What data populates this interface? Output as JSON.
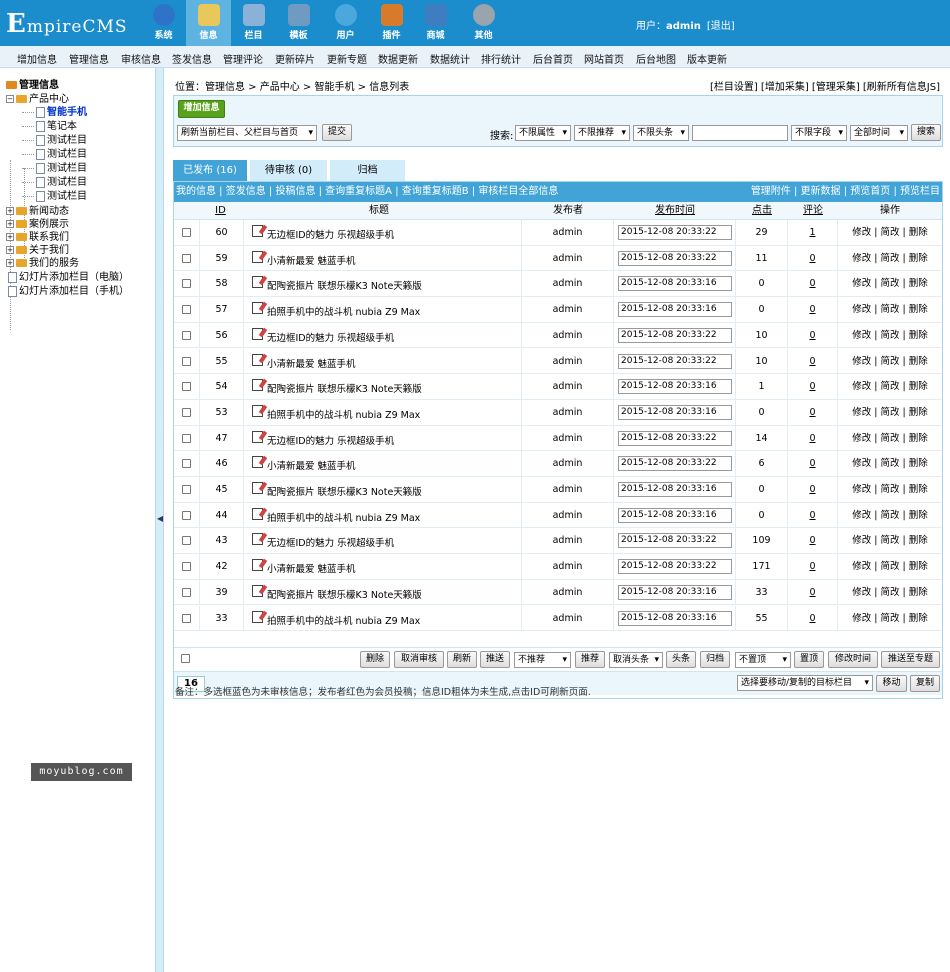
{
  "logo": {
    "text_big": "E",
    "text_rest": "mpireCMS"
  },
  "nav": [
    {
      "label": "系统",
      "icon": "globe-icon",
      "color": "#2f73c8"
    },
    {
      "label": "信息",
      "icon": "notepad-icon",
      "color": "#e8c85a"
    },
    {
      "label": "栏目",
      "icon": "folder-icon",
      "color": "#8ab2d8"
    },
    {
      "label": "模板",
      "icon": "window-icon",
      "color": "#6f9ac2"
    },
    {
      "label": "用户",
      "icon": "user-icon",
      "color": "#4aa8dd"
    },
    {
      "label": "插件",
      "icon": "tools-icon",
      "color": "#d87a2b"
    },
    {
      "label": "商城",
      "icon": "card-icon",
      "color": "#3e7ec0"
    },
    {
      "label": "其他",
      "icon": "gear-icon",
      "color": "#9aa4ad"
    }
  ],
  "user": {
    "label": "用户：",
    "name": "admin",
    "logout": "[退出]"
  },
  "menubar": [
    "增加信息",
    "管理信息",
    "审核信息",
    "签发信息",
    "管理评论",
    "更新碎片",
    "更新专题",
    "数据更新",
    "数据统计",
    "排行统计",
    "后台首页",
    "网站首页",
    "后台地图",
    "版本更新"
  ],
  "tree": {
    "root": "管理信息",
    "product_center": "产品中心",
    "children": [
      "智能手机",
      "笔记本",
      "测试栏目",
      "测试栏目",
      "测试栏目",
      "测试栏目",
      "测试栏目"
    ],
    "groups": [
      "新闻动态",
      "案例展示",
      "联系我们",
      "关于我们",
      "我们的服务"
    ],
    "leaves": [
      "幻灯片添加栏目（电脑）",
      "幻灯片添加栏目（手机）"
    ]
  },
  "watermark": "moyublog.com",
  "position": {
    "label": "位置：",
    "path": "管理信息 > 产品中心 > 智能手机 > 信息列表"
  },
  "toplinks": "[栏目设置] [增加采集] [管理采集] [刷新所有信息JS]",
  "toolbar": {
    "add_label": "增加信息",
    "refresh_select": "刷新当前栏目、父栏目与首页",
    "submit_label": "提交",
    "search_label": "搜索:",
    "attr_select": "不限属性",
    "recommend_select": "不限推荐",
    "headline_select": "不限头条",
    "search_input": "",
    "field_select": "不限字段",
    "time_select": "全部时间",
    "search_button": "搜索"
  },
  "tabs": [
    "已发布 (16)",
    "待审核 (0)",
    "归档"
  ],
  "listhead": {
    "left": "我的信息 | 签发信息 | 投稿信息 | 查询重复标题A | 查询重复标题B | 审核栏目全部信息",
    "right": "管理附件 | 更新数据 | 预览首页 | 预览栏目"
  },
  "columns": {
    "id": "ID",
    "title": "标题",
    "publisher": "发布者",
    "time": "发布时间",
    "clicks": "点击",
    "comments": "评论",
    "ops": "操作"
  },
  "ops_text": "修改 | 简改 | 删除",
  "rows": [
    {
      "id": "60",
      "title": "无边框ID的魅力 乐视超级手机",
      "pub": "admin",
      "time": "2015-12-08 20:33:22",
      "clicks": "29",
      "comments": "1"
    },
    {
      "id": "59",
      "title": "小清新最爱 魅蓝手机",
      "pub": "admin",
      "time": "2015-12-08 20:33:22",
      "clicks": "11",
      "comments": "0"
    },
    {
      "id": "58",
      "title": "配陶瓷振片 联想乐檬K3 Note天籁版",
      "pub": "admin",
      "time": "2015-12-08 20:33:16",
      "clicks": "0",
      "comments": "0"
    },
    {
      "id": "57",
      "title": "拍照手机中的战斗机 nubia Z9 Max",
      "pub": "admin",
      "time": "2015-12-08 20:33:16",
      "clicks": "0",
      "comments": "0"
    },
    {
      "id": "56",
      "title": "无边框ID的魅力 乐视超级手机",
      "pub": "admin",
      "time": "2015-12-08 20:33:22",
      "clicks": "10",
      "comments": "0"
    },
    {
      "id": "55",
      "title": "小清新最爱 魅蓝手机",
      "pub": "admin",
      "time": "2015-12-08 20:33:22",
      "clicks": "10",
      "comments": "0"
    },
    {
      "id": "54",
      "title": "配陶瓷振片 联想乐檬K3 Note天籁版",
      "pub": "admin",
      "time": "2015-12-08 20:33:16",
      "clicks": "1",
      "comments": "0"
    },
    {
      "id": "53",
      "title": "拍照手机中的战斗机 nubia Z9 Max",
      "pub": "admin",
      "time": "2015-12-08 20:33:16",
      "clicks": "0",
      "comments": "0"
    },
    {
      "id": "47",
      "title": "无边框ID的魅力 乐视超级手机",
      "pub": "admin",
      "time": "2015-12-08 20:33:22",
      "clicks": "14",
      "comments": "0"
    },
    {
      "id": "46",
      "title": "小清新最爱 魅蓝手机",
      "pub": "admin",
      "time": "2015-12-08 20:33:22",
      "clicks": "6",
      "comments": "0"
    },
    {
      "id": "45",
      "title": "配陶瓷振片 联想乐檬K3 Note天籁版",
      "pub": "admin",
      "time": "2015-12-08 20:33:16",
      "clicks": "0",
      "comments": "0"
    },
    {
      "id": "44",
      "title": "拍照手机中的战斗机 nubia Z9 Max",
      "pub": "admin",
      "time": "2015-12-08 20:33:16",
      "clicks": "0",
      "comments": "0"
    },
    {
      "id": "43",
      "title": "无边框ID的魅力 乐视超级手机",
      "pub": "admin",
      "time": "2015-12-08 20:33:22",
      "clicks": "109",
      "comments": "0"
    },
    {
      "id": "42",
      "title": "小清新最爱 魅蓝手机",
      "pub": "admin",
      "time": "2015-12-08 20:33:22",
      "clicks": "171",
      "comments": "0"
    },
    {
      "id": "39",
      "title": "配陶瓷振片 联想乐檬K3 Note天籁版",
      "pub": "admin",
      "time": "2015-12-08 20:33:16",
      "clicks": "33",
      "comments": "0"
    },
    {
      "id": "33",
      "title": "拍照手机中的战斗机 nubia Z9 Max",
      "pub": "admin",
      "time": "2015-12-08 20:33:16",
      "clicks": "55",
      "comments": "0"
    }
  ],
  "bottom": {
    "delete": "删除",
    "unaudit": "取消审核",
    "refresh": "刷新",
    "push": "推送",
    "recommend_select": "不推荐",
    "recommend": "推荐",
    "headline_select": "取消头条",
    "headline": "头条",
    "archive": "归档",
    "top_select": "不置顶",
    "top": "置顶",
    "edit_time": "修改时间",
    "push_topic": "推送至专题"
  },
  "pager": {
    "count": "16",
    "target_select": "选择要移动/复制的目标栏目",
    "move": "移动",
    "copy": "复制"
  },
  "note": "备注：多选框蓝色为未审核信息；发布者红色为会员投稿；信息ID粗体为未生成,点击ID可刷新页面."
}
